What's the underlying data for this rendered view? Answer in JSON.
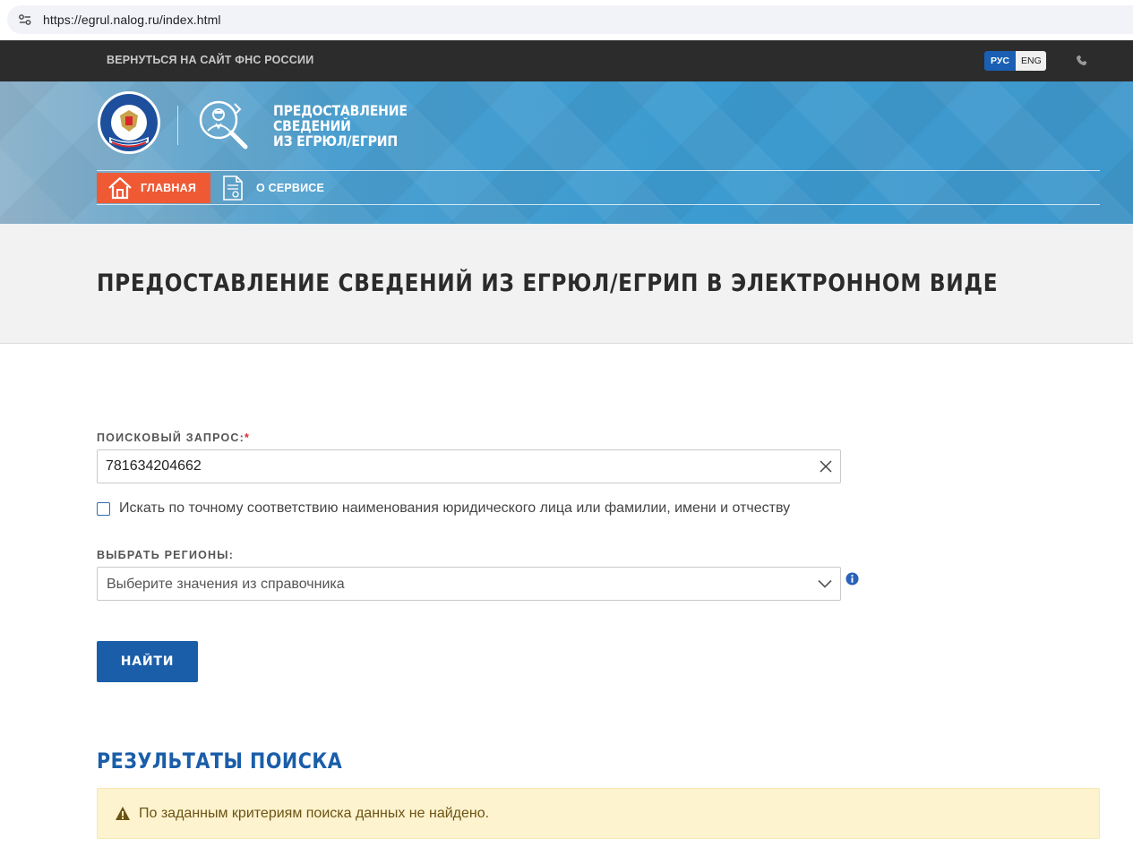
{
  "browser": {
    "url": "https://egrul.nalog.ru/index.html"
  },
  "topbar": {
    "back_link": "ВЕРНУТЬСЯ НА САЙТ ФНС РОССИИ",
    "lang_ru": "РУС",
    "lang_en": "ENG",
    "active_lang": "РУС"
  },
  "header": {
    "service_title_line1": "ПРЕДОСТАВЛЕНИЕ",
    "service_title_line2": "СВЕДЕНИЙ",
    "service_title_line3": "ИЗ ЕГРЮЛ/ЕГРИП",
    "nav": {
      "home": "ГЛАВНАЯ",
      "about": "О СЕРВИСЕ"
    }
  },
  "page": {
    "title": "ПРЕДОСТАВЛЕНИЕ СВЕДЕНИЙ ИЗ ЕГРЮЛ/ЕГРИП В ЭЛЕКТРОННОМ ВИДЕ"
  },
  "form": {
    "query_label": "ПОИСКОВЫЙ ЗАПРОС:",
    "required_mark": "*",
    "query_value": "781634204662",
    "exact_match_label": "Искать по точному соответствию наименования юридического лица или фамилии, имени и отчеству",
    "exact_match_checked": false,
    "regions_label": "ВЫБРАТЬ РЕГИОНЫ:",
    "regions_placeholder": "Выберите значения из справочника",
    "submit_label": "НАЙТИ"
  },
  "results": {
    "title": "РЕЗУЛЬТАТЫ ПОИСКА",
    "message": "По заданным критериям поиска данных не найдено."
  },
  "colors": {
    "accent_blue": "#1a5ea9",
    "nav_orange": "#ef5a35",
    "alert_bg": "#fdf3ce",
    "topbar_dark": "#2c2c2c"
  }
}
